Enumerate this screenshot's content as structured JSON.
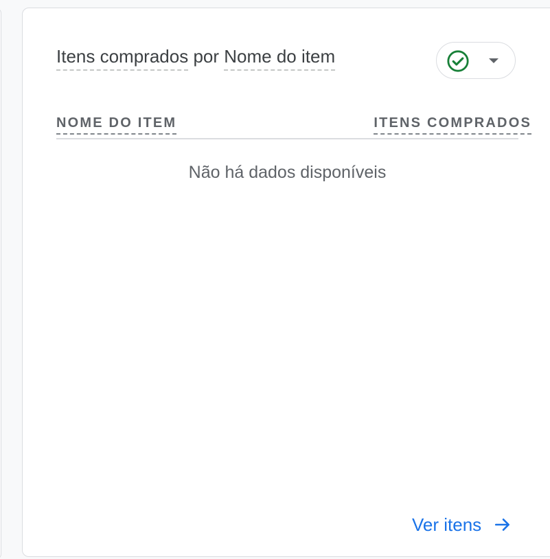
{
  "card": {
    "title": {
      "metric": "Itens comprados",
      "connector": "por",
      "dimension": "Nome do item"
    },
    "status_icon": "check-circle-icon",
    "dropdown_icon": "caret-down-icon",
    "table": {
      "columns": [
        "NOME DO ITEM",
        "ITENS COMPRADOS"
      ]
    },
    "empty_message": "Não há dados disponíveis",
    "link": {
      "label": "Ver itens",
      "icon": "arrow-right-icon"
    }
  },
  "colors": {
    "status_ok": "#188038",
    "link": "#1a73e8",
    "text": "#3c4043",
    "muted": "#5f6368",
    "border": "#dadce0"
  }
}
